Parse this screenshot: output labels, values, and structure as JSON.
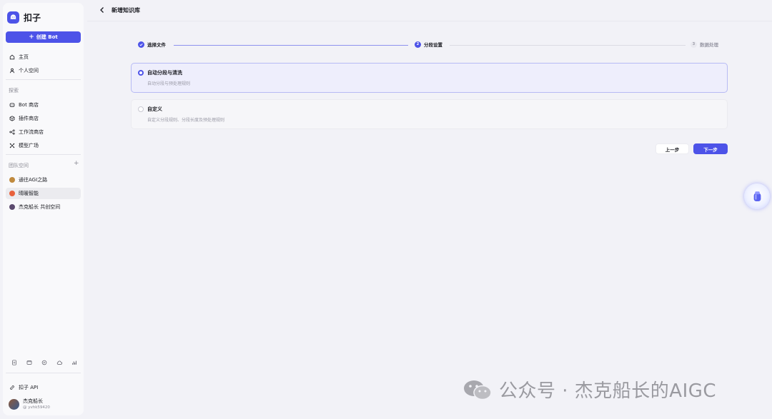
{
  "brand": {
    "name": "扣子"
  },
  "sidebar": {
    "create_label": "创建 Bot",
    "main_items": [
      {
        "label": "主页"
      },
      {
        "label": "个人空间"
      }
    ],
    "explore_label": "探索",
    "explore_items": [
      {
        "label": "Bot 商店"
      },
      {
        "label": "插件商店"
      },
      {
        "label": "工作流商店"
      },
      {
        "label": "模型广场"
      }
    ],
    "team_label": "团队空间",
    "team_items": [
      {
        "label": "通往AGI之路"
      },
      {
        "label": "晴暖智能"
      },
      {
        "label": "杰克船长 共创空间"
      }
    ],
    "api_label": "扣子 API",
    "user": {
      "name": "杰克船长",
      "id": "@ yvhk59420"
    }
  },
  "header": {
    "title": "新增知识库"
  },
  "stepper": {
    "steps": [
      {
        "label": "选择文件",
        "index": "1",
        "state": "done"
      },
      {
        "label": "分段设置",
        "index": "2",
        "state": "active"
      },
      {
        "label": "数据处理",
        "index": "3",
        "state": "pending"
      }
    ]
  },
  "options": [
    {
      "title": "自动分段与清洗",
      "desc": "自动分段与预处理规则",
      "selected": true
    },
    {
      "title": "自定义",
      "desc": "自定义分段规则、分段长度及预处理规则",
      "selected": false
    }
  ],
  "actions": {
    "prev_label": "上一步",
    "next_label": "下一步"
  },
  "watermark": {
    "text": "公众号 · 杰克船长的AIGC"
  },
  "colors": {
    "accent": "#4d53e8",
    "selected_bg": "#eeeefc",
    "page_bg": "#f2f2f7"
  }
}
